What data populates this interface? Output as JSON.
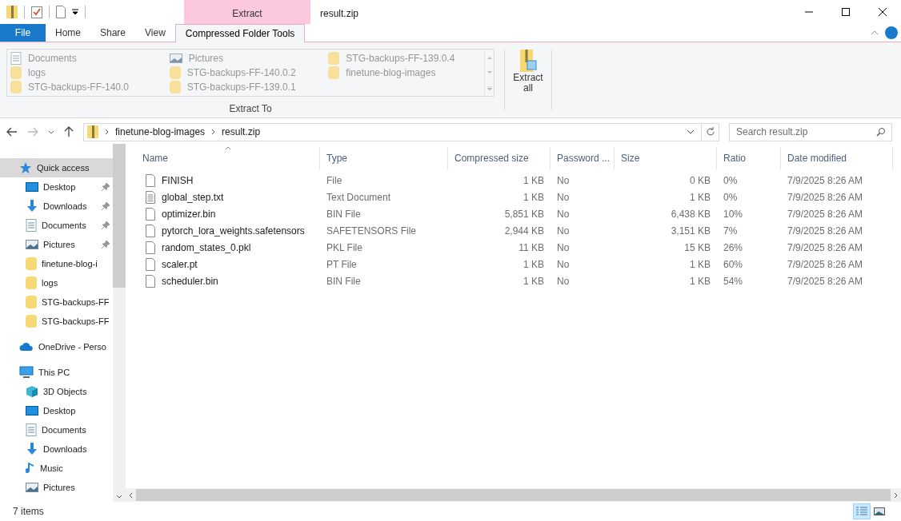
{
  "window": {
    "title": "result.zip",
    "context_tab": "Extract"
  },
  "ribbon_tabs": [
    {
      "label": "File",
      "kind": "file",
      "selected": false
    },
    {
      "label": "Home",
      "kind": "tab",
      "selected": false
    },
    {
      "label": "Share",
      "kind": "tab",
      "selected": false
    },
    {
      "label": "View",
      "kind": "tab",
      "selected": false
    },
    {
      "label": "Compressed Folder Tools",
      "kind": "context",
      "selected": true
    }
  ],
  "extract_to": {
    "label": "Extract To",
    "items": [
      {
        "label": "Documents",
        "kind": "documents"
      },
      {
        "label": "logs",
        "kind": "folder"
      },
      {
        "label": "STG-backups-FF-140.0",
        "kind": "folder"
      },
      {
        "label": "Pictures",
        "kind": "pictures"
      },
      {
        "label": "STG-backups-FF-140.0.2",
        "kind": "folder"
      },
      {
        "label": "STG-backups-FF-139.0.1",
        "kind": "folder"
      },
      {
        "label": "STG-backups-FF-139.0.4",
        "kind": "folder"
      },
      {
        "label": "finetune-blog-images",
        "kind": "folder"
      }
    ]
  },
  "extract_all": {
    "label": "Extract all"
  },
  "address": {
    "crumbs": [
      "finetune-blog-images",
      "result.zip"
    ],
    "search_placeholder": "Search result.zip"
  },
  "sidebar": [
    {
      "label": "Quick access",
      "kind": "star",
      "selected": true,
      "children": [
        {
          "label": "Desktop",
          "kind": "desktop",
          "pinned": true,
          "selected": false
        },
        {
          "label": "Downloads",
          "kind": "downloads",
          "pinned": true,
          "selected": false
        },
        {
          "label": "Documents",
          "kind": "documents",
          "pinned": true,
          "selected": false
        },
        {
          "label": "Pictures",
          "kind": "pictures",
          "pinned": true,
          "selected": false
        },
        {
          "label": "finetune-blog-i",
          "kind": "folder",
          "pinned": false,
          "selected": false
        },
        {
          "label": "logs",
          "kind": "folder",
          "pinned": false,
          "selected": false
        },
        {
          "label": "STG-backups-FF",
          "kind": "folder",
          "pinned": false,
          "selected": false
        },
        {
          "label": "STG-backups-FF",
          "kind": "folder",
          "pinned": false,
          "selected": false
        }
      ]
    },
    {
      "label": "OneDrive - Perso",
      "kind": "cloud",
      "selected": false
    },
    {
      "label": "This PC",
      "kind": "pc",
      "selected": false,
      "children": [
        {
          "label": "3D Objects",
          "kind": "cube",
          "pinned": false,
          "selected": false
        },
        {
          "label": "Desktop",
          "kind": "desktop",
          "pinned": false,
          "selected": false
        },
        {
          "label": "Documents",
          "kind": "documents",
          "pinned": false,
          "selected": false
        },
        {
          "label": "Downloads",
          "kind": "downloads",
          "pinned": false,
          "selected": false
        },
        {
          "label": "Music",
          "kind": "music",
          "pinned": false,
          "selected": false
        },
        {
          "label": "Pictures",
          "kind": "pictures",
          "pinned": false,
          "selected": false
        }
      ]
    }
  ],
  "table": {
    "columns": [
      {
        "label": "Name",
        "sorted": true
      },
      {
        "label": "Type",
        "sorted": false
      },
      {
        "label": "Compressed size",
        "sorted": false
      },
      {
        "label": "Password ...",
        "sorted": false
      },
      {
        "label": "Size",
        "sorted": false
      },
      {
        "label": "Ratio",
        "sorted": false
      },
      {
        "label": "Date modified",
        "sorted": false
      }
    ],
    "rows": [
      {
        "kind": "file",
        "cells": [
          "FINISH",
          "File",
          "1 KB",
          "No",
          "0 KB",
          "0%",
          "7/9/2025 8:26 AM"
        ]
      },
      {
        "kind": "text",
        "cells": [
          "global_step.txt",
          "Text Document",
          "1 KB",
          "No",
          "1 KB",
          "0%",
          "7/9/2025 8:26 AM"
        ]
      },
      {
        "kind": "file",
        "cells": [
          "optimizer.bin",
          "BIN File",
          "5,851 KB",
          "No",
          "6,438 KB",
          "10%",
          "7/9/2025 8:26 AM"
        ]
      },
      {
        "kind": "file",
        "cells": [
          "pytorch_lora_weights.safetensors",
          "SAFETENSORS File",
          "2,944 KB",
          "No",
          "3,151 KB",
          "7%",
          "7/9/2025 8:26 AM"
        ]
      },
      {
        "kind": "file",
        "cells": [
          "random_states_0.pkl",
          "PKL File",
          "11 KB",
          "No",
          "15 KB",
          "26%",
          "7/9/2025 8:26 AM"
        ]
      },
      {
        "kind": "file",
        "cells": [
          "scaler.pt",
          "PT File",
          "1 KB",
          "No",
          "1 KB",
          "60%",
          "7/9/2025 8:26 AM"
        ]
      },
      {
        "kind": "file",
        "cells": [
          "scheduler.bin",
          "BIN File",
          "1 KB",
          "No",
          "1 KB",
          "54%",
          "7/9/2025 8:26 AM"
        ]
      }
    ]
  },
  "status_bar": {
    "count": "7 items",
    "view_buttons": [
      {
        "kind": "details",
        "selected": true
      },
      {
        "kind": "thumbnails",
        "selected": false
      }
    ]
  }
}
